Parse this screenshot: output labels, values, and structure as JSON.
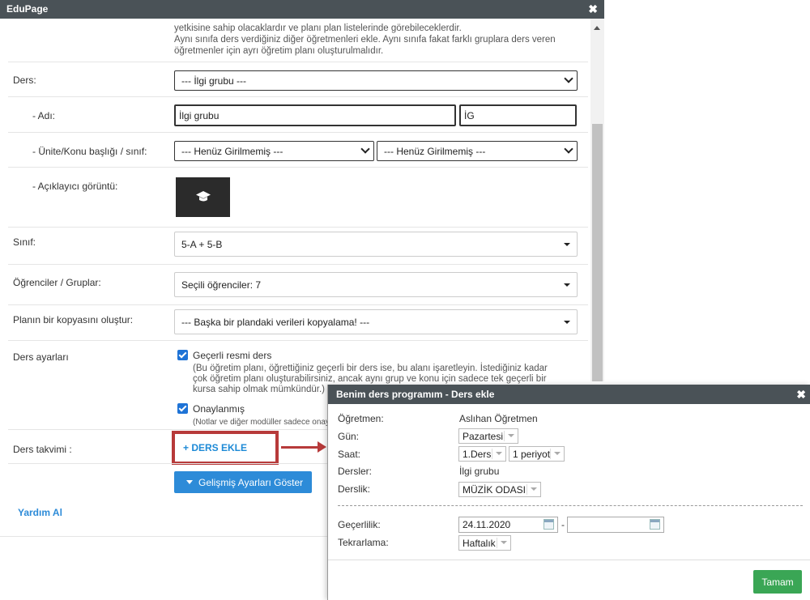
{
  "window": {
    "title": "EduPage",
    "close_glyph": "✖"
  },
  "intro": {
    "line1": "yetkisine sahip olacaklardır ve planı plan listelerinde görebileceklerdir.",
    "line2": "Aynı sınıfa ders verdiğiniz diğer öğretmenleri ekle. Aynı sınıfa fakat farklı gruplara ders veren",
    "line3": "öğretmenler için ayrı öğretim planı oluşturulmalıdır."
  },
  "form": {
    "ders": {
      "label": "Ders:",
      "value": "--- İlgi grubu ---"
    },
    "adi": {
      "label": "- Adı:",
      "value": "İlgi grubu",
      "short": "İG"
    },
    "unite": {
      "label": "- Ünite/Konu başlığı / sınıf:",
      "value1": "--- Henüz Girilmemiş ---",
      "value2": "--- Henüz Girilmemiş ---"
    },
    "gorunt": {
      "label": "- Açıklayıcı görüntü:"
    },
    "sinif": {
      "label": "Sınıf:",
      "value": "5-A + 5-B"
    },
    "ogrenciler": {
      "label": "Öğrenciler / Gruplar:",
      "value": "Seçili öğrenciler: 7"
    },
    "kopya": {
      "label": "Planın bir kopyasını oluştur:",
      "value": "--- Başka bir plandaki verileri kopyalama! ---"
    },
    "ayarlar": {
      "label": "Ders ayarları",
      "cb1_label": "Geçerli resmi ders",
      "cb1_note1": "(Bu öğretim planı, öğrettiğiniz geçerli bir ders ise, bu alanı işaretleyin. İstediğiniz kadar",
      "cb1_note2": "çok öğretim planı oluşturabilirsiniz, ancak aynı grup ve konu için sadece tek geçerli bir",
      "cb1_note3": "kursa sahip olmak mümkündür.)",
      "cb2_label": "Onaylanmış",
      "cb2_note": "(Notlar ve diğer modüller sadece onay"
    },
    "takvim": {
      "label": "Ders takvimi :",
      "add_link": "+ DERS EKLE"
    },
    "advanced_button": "Gelişmiş Ayarları Göster",
    "help_link": "Yardım Al"
  },
  "dialog": {
    "title": "Benim ders programım - Ders ekle",
    "close_glyph": "✖",
    "ogretmen_label": "Öğretmen:",
    "ogretmen_value": "Aslıhan Öğretmen",
    "gun_label": "Gün:",
    "gun_value": "Pazartesi",
    "saat_label": "Saat:",
    "saat_value": "1.Ders",
    "saat_period": "1 periyot",
    "dersler_label": "Dersler:",
    "dersler_value": "İlgi grubu",
    "derslik_label": "Derslik:",
    "derslik_value": "MÜZİK ODASI",
    "gecerlilik_label": "Geçerlilik:",
    "gecerlilik_from": "24.11.2020",
    "gecerlilik_dash": "-",
    "gecerlilik_to": "",
    "tekrarlama_label": "Tekrarlama:",
    "tekrarlama_value": "Haftalık",
    "ok_button": "Tamam"
  }
}
